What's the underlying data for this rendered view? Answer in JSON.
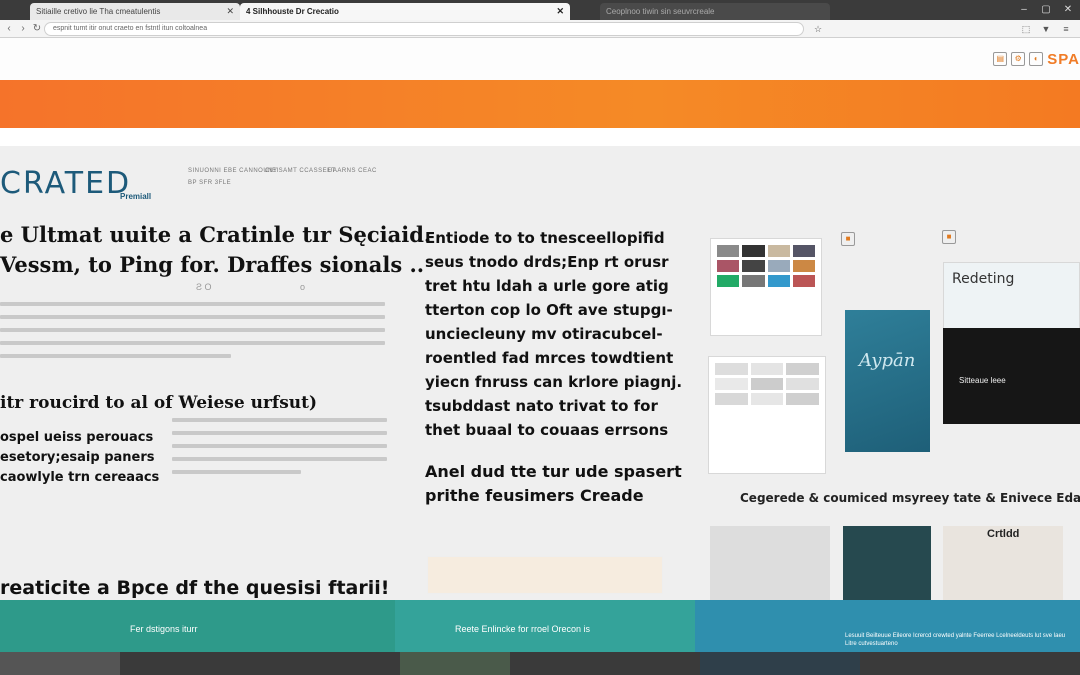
{
  "browser": {
    "tabs": [
      {
        "label": "Sitiaille cretivo lie Tha cmeatulentis",
        "active": false
      },
      {
        "label": "4 Silhhouste Dr Crecatio",
        "active": true
      },
      {
        "label": "Ceoplnoo tiwin sin seuvrcreale",
        "active": false
      }
    ],
    "url": "espnit tumt itir onut craeto en fstntl itun coltoalnea"
  },
  "header": {
    "logo_text": "SPA"
  },
  "brand": {
    "name": "CRATED",
    "sub": "Premiall",
    "nav": [
      "SINUONNI EBE CANNOUNY",
      "CIEISAMT CCASSEET",
      "UAARNS CEAC"
    ],
    "tagline": "BP SFR 3FLE"
  },
  "left": {
    "headline": [
      "e Ultmat uuite a Cratinle tır Sęciaid.",
      "Vessm, to Ping  for. Draffes sionals .."
    ],
    "chips": [
      "Ƨ O",
      "ᴏ"
    ],
    "subhead": "itr roucird to al of Weiese urfsut)",
    "bullets": [
      "ospel ueiss perouacs",
      "esetory;esaip paners",
      "caowlyle trn cereaacs"
    ],
    "caption": "reaticite a Bpce df the quesisi ftarii!"
  },
  "middle": {
    "lines": [
      "Entiode to to tnesceellopifid",
      "seus tnodo drds;Enp rt orusr",
      "tret htu ldah a urle gore atig",
      "tterton cop lo Oft ave stupgı-",
      "unciecleuny mv otiracubcel-",
      "roentled fad mrces towdtient",
      "yiecn fnruss can krlore piagnj.",
      "tsubddast nato trivat to for",
      "thet buaal to couaas errsons"
    ],
    "subhead": [
      "Anel dud tte tur ude spasert",
      "prithe feusimers Creade"
    ]
  },
  "right": {
    "card_title": "Redeting",
    "script_text": "Aypān",
    "dark_text": "Sitteaue leee",
    "section_heading": "Cegerede & coumiced msyreey tate & Enivece Edab-",
    "photo_label": "Crtldd"
  },
  "footer": {
    "left_text": "Fer dstigons iturr",
    "mid_text": "Reete Enlincke for rroel Orecon is",
    "right_text": "Lesuuit Beilteuue Eileore Icrercd crewted yalnte Feerree Lcelneeldeuts lut sve laeu Litre cutvestuarteno"
  },
  "colors": {
    "orange": "#f5822a",
    "teal": "#2e9a8a",
    "blue": "#2f8fae",
    "brand_blue": "#1d5a7a"
  }
}
